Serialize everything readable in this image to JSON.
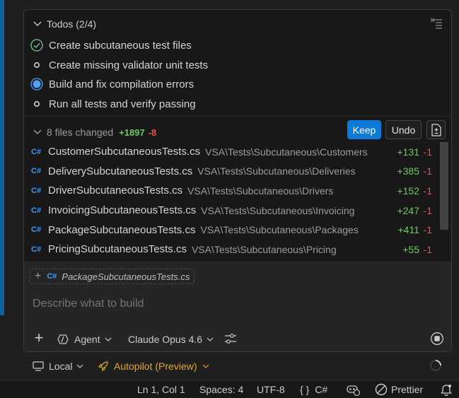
{
  "todos": {
    "title": "Todos (2/4)",
    "items": [
      {
        "label": "Create subcutaneous test files",
        "status": "completed"
      },
      {
        "label": "Create missing validator unit tests",
        "status": "not-started"
      },
      {
        "label": "Build and fix compilation errors",
        "status": "in-progress"
      },
      {
        "label": "Run all tests and verify passing",
        "status": "not-started"
      }
    ]
  },
  "changes": {
    "summary": "8 files changed",
    "added": "+1897",
    "removed": "-8",
    "keep_label": "Keep",
    "undo_label": "Undo",
    "files": [
      {
        "icon": "csharp-file-icon",
        "name": "CustomerSubcutaneousTests.cs",
        "path": "VSA\\Tests\\Subcutaneous\\Customers",
        "added": "+131",
        "removed": "-1"
      },
      {
        "icon": "csharp-file-icon",
        "name": "DeliverySubcutaneousTests.cs",
        "path": "VSA\\Tests\\Subcutaneous\\Deliveries",
        "added": "+385",
        "removed": "-1"
      },
      {
        "icon": "csharp-file-icon",
        "name": "DriverSubcutaneousTests.cs",
        "path": "VSA\\Tests\\Subcutaneous\\Drivers",
        "added": "+152",
        "removed": "-1"
      },
      {
        "icon": "csharp-file-icon",
        "name": "InvoicingSubcutaneousTests.cs",
        "path": "VSA\\Tests\\Subcutaneous\\Invoicing",
        "added": "+247",
        "removed": "-1"
      },
      {
        "icon": "csharp-file-icon",
        "name": "PackageSubcutaneousTests.cs",
        "path": "VSA\\Tests\\Subcutaneous\\Packages",
        "added": "+411",
        "removed": "-1"
      },
      {
        "icon": "csharp-file-icon",
        "name": "PricingSubcutaneousTests.cs",
        "path": "VSA\\Tests\\Subcutaneous\\Pricing",
        "added": "+55",
        "removed": "-1"
      }
    ]
  },
  "composer": {
    "context_chip": "PackageSubcutaneousTests.cs",
    "placeholder": "Describe what to build",
    "mode": "Agent",
    "model": "Claude Opus 4.6"
  },
  "session": {
    "location": "Local",
    "approval_mode": "Autopilot (Preview)"
  },
  "statusbar": {
    "position": "Ln 1, Col 1",
    "indent": "Spaces: 4",
    "encoding": "UTF-8",
    "language_symbol": "{ }",
    "language": "C#",
    "formatter": "Prettier"
  },
  "colors": {
    "accent": "#0e7ad8",
    "added": "#6ccb5f",
    "removed": "#f14c4c",
    "autopilot": "#e5a72b",
    "csharp_icon": "#3b9cff",
    "completed": "#73c991",
    "in_progress": "#4aa3ff"
  }
}
